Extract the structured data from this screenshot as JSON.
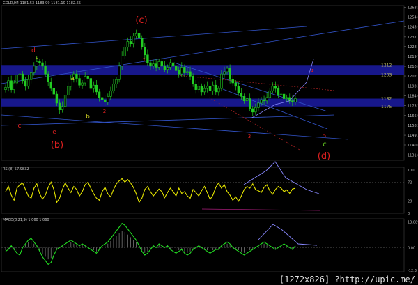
{
  "headers": {
    "main": "GOLD,H4  1181.53 1183.99 1181.10 1182.65",
    "rsi": "RSI(8) 57.9832",
    "macd": "MACD(8,21,9) 1.060 1.060"
  },
  "watermark": "[1272x826] ?http://upic.me/",
  "colors": {
    "background": "#000000",
    "candle": "#22cc22",
    "zone": "#1a1a9a",
    "rsi_line": "#e8e800",
    "macd_line": "#22dd22",
    "wave_red": "#e02020",
    "wave_yellow": "#cccc22",
    "wave_green": "#66cc22",
    "trend_line": "#3355cc",
    "arrow": "#8888ff"
  },
  "chart_data": [
    {
      "type": "candlestick",
      "symbol": "GOLD",
      "timeframe": "H4",
      "ohlc_current": {
        "open": 1181.53,
        "high": 1183.99,
        "low": 1181.1,
        "close": 1182.65
      },
      "ylim": [
        1127.0,
        1265.0
      ],
      "y_ticks": [
        "1263.53",
        "1254.65",
        "1245.98",
        "1237.10",
        "1228.43",
        "1219.75",
        "1210.88",
        "1202.20",
        "1193.33",
        "1184.65",
        "1175.78",
        "1166.90",
        "1158.23",
        "1149.35",
        "1140.68",
        "1131.80"
      ],
      "price_levels": [
        {
          "label": "1212",
          "value": 1212
        },
        {
          "label": "1203",
          "value": 1203
        },
        {
          "label": "1182",
          "value": 1182
        },
        {
          "label": "1175",
          "value": 1175
        }
      ],
      "zones": [
        {
          "from": 1203,
          "to": 1212
        },
        {
          "from": 1175,
          "to": 1182
        }
      ],
      "close_series": [
        1192,
        1198,
        1190,
        1196,
        1203,
        1204,
        1198,
        1193,
        1199,
        1205,
        1211,
        1215,
        1214,
        1211,
        1204,
        1197,
        1191,
        1186,
        1178,
        1172,
        1175,
        1185,
        1193,
        1199,
        1204,
        1200,
        1194,
        1196,
        1202,
        1200,
        1191,
        1194,
        1188,
        1183,
        1181,
        1179,
        1184,
        1189,
        1195,
        1199,
        1211,
        1220,
        1228,
        1233,
        1231,
        1238,
        1240,
        1236,
        1228,
        1221,
        1214,
        1211,
        1213,
        1210,
        1215,
        1211,
        1208,
        1210,
        1214,
        1211,
        1207,
        1204,
        1210,
        1205,
        1206,
        1202,
        1195,
        1190,
        1193,
        1188,
        1191,
        1193,
        1189,
        1194,
        1188,
        1191,
        1204,
        1206,
        1209,
        1199,
        1196,
        1193,
        1187,
        1184,
        1180,
        1182,
        1173,
        1170,
        1174,
        1178,
        1181,
        1180,
        1183,
        1189,
        1193,
        1191,
        1185,
        1186,
        1182,
        1183,
        1180,
        1179,
        1182
      ],
      "wave_labels": [
        {
          "text": "(b)",
          "color": "red"
        },
        {
          "text": "(c)",
          "color": "red"
        },
        {
          "text": "(d)",
          "color": "red"
        },
        {
          "text": "d",
          "color": "red"
        },
        {
          "text": "c",
          "color": "yellow"
        },
        {
          "text": "e",
          "color": "red"
        },
        {
          "text": "c",
          "color": "red"
        },
        {
          "text": "a",
          "color": "yellow"
        },
        {
          "text": "b",
          "color": "yellow"
        },
        {
          "text": "c",
          "color": "green"
        },
        {
          "text": "3",
          "color": "red"
        },
        {
          "text": "2",
          "color": "red"
        },
        {
          "text": "4",
          "color": "red"
        },
        {
          "text": "5",
          "color": "red"
        },
        {
          "text": "1",
          "color": "red"
        }
      ]
    },
    {
      "type": "line",
      "indicator": "RSI",
      "period": 8,
      "value": 57.9832,
      "ylim": [
        0,
        100
      ],
      "y_ticks": [
        "100",
        "72",
        "28",
        "0"
      ],
      "series": [
        50,
        62,
        42,
        30,
        58,
        66,
        70,
        55,
        40,
        35,
        58,
        68,
        45,
        33,
        42,
        60,
        72,
        55,
        25,
        35,
        55,
        70,
        58,
        48,
        62,
        55,
        40,
        50,
        66,
        72,
        58,
        45,
        35,
        30,
        50,
        60,
        45,
        38,
        55,
        68,
        75,
        80,
        72,
        78,
        70,
        60,
        45,
        25,
        35,
        55,
        62,
        50,
        40,
        48,
        56,
        50,
        36,
        48,
        58,
        50,
        40,
        58,
        46,
        50,
        40,
        35,
        55,
        48,
        40,
        52,
        62,
        48,
        32,
        42,
        60,
        70,
        58,
        66,
        50,
        42,
        30,
        38,
        28,
        40,
        55,
        62,
        58,
        68,
        55,
        52,
        48,
        60,
        66,
        52,
        44,
        55,
        62,
        58,
        50,
        54,
        46,
        56,
        58
      ]
    },
    {
      "type": "line",
      "indicator": "MACD",
      "params": [
        8,
        21,
        9
      ],
      "value": 1.06,
      "signal": 1.06,
      "y_ticks": [
        "13.889",
        "0.00",
        "-12.3"
      ],
      "series": [
        -2,
        -1,
        1,
        -1,
        -3,
        -4,
        0,
        2,
        4,
        5,
        3,
        1,
        -2,
        -5,
        -7,
        -9,
        -8,
        -4,
        -1,
        0,
        1,
        2,
        3,
        4,
        3,
        2,
        1,
        2,
        1,
        0,
        -1,
        -2,
        -3,
        -1,
        1,
        2,
        3,
        5,
        7,
        9,
        11,
        13,
        12,
        10,
        8,
        6,
        4,
        1,
        -2,
        -4,
        -3,
        -1,
        1,
        0,
        2,
        1,
        0,
        1,
        -1,
        -2,
        -3,
        -2,
        -1,
        -3,
        -4,
        -3,
        -1,
        0,
        1,
        0,
        -1,
        -2,
        -3,
        -2,
        -1,
        -1,
        1,
        2,
        3,
        2,
        0,
        -1,
        -2,
        -3,
        -4,
        -3,
        -2,
        -1,
        0,
        1,
        2,
        3,
        2,
        1,
        0,
        -1,
        0,
        1,
        2,
        1,
        0,
        -1,
        1
      ]
    }
  ]
}
